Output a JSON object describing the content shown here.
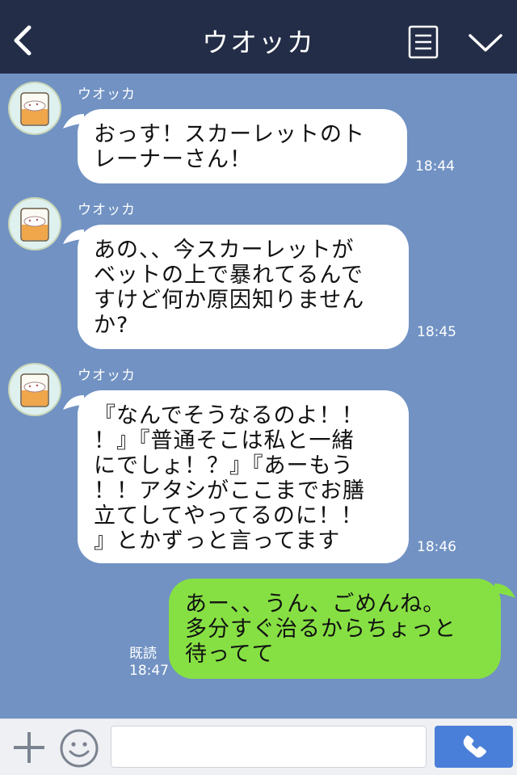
{
  "header": {
    "title": "ウオッカ",
    "back_icon": "chevron-left-icon",
    "menu_icon": "menu-icon",
    "collapse_icon": "chevron-down-icon"
  },
  "messages": [
    {
      "sender": "ウオッカ",
      "lines": [
        "おっす！スカーレットのト",
        "レーナーさん！"
      ],
      "time": "18:44"
    },
    {
      "sender": "ウオッカ",
      "lines": [
        "あの、、今スカーレットが",
        "ベットの上で暴れてるんで",
        "すけど何か原因知りません",
        "か?"
      ],
      "time": "18:45"
    },
    {
      "sender": "ウオッカ",
      "lines": [
        "『なんでそうなるのよ！！",
        "！』『普通そこは私と一緒",
        "にでしょ！？』『あーもう",
        "！！アタシがここまでお膳",
        "立てしてやってるのに！！",
        "』とかずっと言ってます"
      ],
      "time": "18:46"
    }
  ],
  "my_message": {
    "lines": [
      "あー、、うん、ごめんね。",
      "多分すぐ治るからちょっと",
      "待ってて"
    ],
    "read_label": "既読",
    "time": "18:47"
  },
  "input_bar": {
    "message_value": "",
    "plus_icon": "plus-icon",
    "emoji_icon": "smiley-icon",
    "call_icon": "phone-icon"
  },
  "colors": {
    "header_bg": "#232d47",
    "chat_bg": "#7192c3",
    "incoming_bubble": "#ffffff",
    "outgoing_bubble": "#86e043",
    "call_button": "#4a7fd9"
  }
}
